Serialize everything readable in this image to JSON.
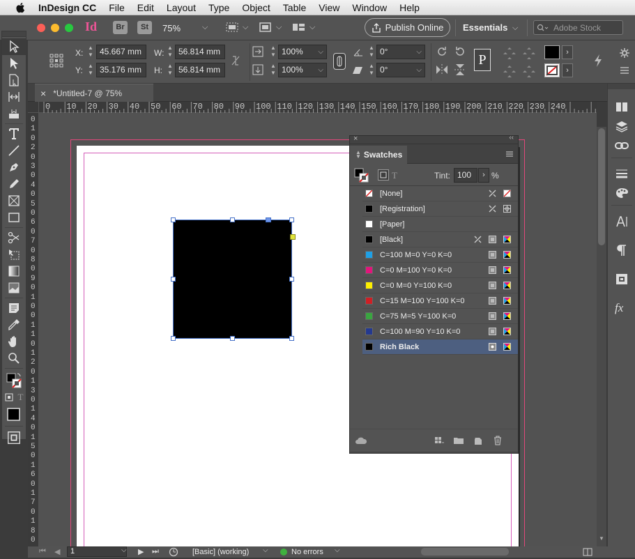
{
  "menu": {
    "apple": "apple-logo",
    "items": [
      "InDesign CC",
      "File",
      "Edit",
      "Layout",
      "Type",
      "Object",
      "Table",
      "View",
      "Window",
      "Help"
    ]
  },
  "appbar": {
    "logo": "Id",
    "bridge": "Br",
    "stock_app": "St",
    "zoom": "75%",
    "publish": "Publish Online",
    "workspace": "Essentials",
    "search_placeholder": "Adobe Stock"
  },
  "control": {
    "x_label": "X:",
    "x_value": "45.667 mm",
    "y_label": "Y:",
    "y_value": "35.176 mm",
    "w_label": "W:",
    "w_value": "56.814 mm",
    "h_label": "H:",
    "h_value": "56.814 mm",
    "scale_x": "100%",
    "scale_y": "100%",
    "rotate": "0°",
    "shear": "0°",
    "p_glyph": "P"
  },
  "document": {
    "tab_title": "*Untitled-7 @ 75%",
    "close": "×"
  },
  "ruler": {
    "h_ticks": [
      "0",
      "10",
      "20",
      "30",
      "40",
      "50",
      "60",
      "70",
      "80",
      "90",
      "100",
      "110",
      "120",
      "130",
      "140",
      "150",
      "160",
      "170",
      "180",
      "190",
      "200",
      "210",
      "220",
      "230",
      "240"
    ],
    "v_ticks": [
      "0",
      "1",
      "0",
      "2",
      "0",
      "3",
      "0",
      "4",
      "0",
      "5",
      "0",
      "6",
      "0",
      "7",
      "0",
      "8",
      "0",
      "9",
      "0",
      "1",
      "0",
      "0",
      "1",
      "1",
      "0",
      "1",
      "2",
      "0",
      "1",
      "3",
      "0",
      "1",
      "4",
      "0",
      "1",
      "5",
      "0",
      "1",
      "6",
      "0",
      "1",
      "7",
      "0",
      "1",
      "8",
      "0"
    ]
  },
  "swatches": {
    "title": "Swatches",
    "tint_label": "Tint:",
    "tint_value": "100",
    "tint_unit": "%",
    "text_toggle": "T",
    "rows": [
      {
        "name": "[None]",
        "color": "none"
      },
      {
        "name": "[Registration]",
        "color": "#000000"
      },
      {
        "name": "[Paper]",
        "color": "#ffffff"
      },
      {
        "name": "[Black]",
        "color": "#000000"
      },
      {
        "name": "C=100 M=0 Y=0 K=0",
        "color": "#1ea0e6"
      },
      {
        "name": "C=0 M=100 Y=0 K=0",
        "color": "#e2157b"
      },
      {
        "name": "C=0 M=0 Y=100 K=0",
        "color": "#fff000"
      },
      {
        "name": "C=15 M=100 Y=100 K=0",
        "color": "#cf1f25"
      },
      {
        "name": "C=75 M=5 Y=100 K=0",
        "color": "#3aa540"
      },
      {
        "name": "C=100 M=90 Y=10 K=0",
        "color": "#24398f"
      },
      {
        "name": "Rich Black",
        "color": "#000000"
      }
    ]
  },
  "status": {
    "page": "1",
    "style": "[Basic] (working)",
    "errors": "No errors",
    "error_color": "#3fb13f"
  }
}
